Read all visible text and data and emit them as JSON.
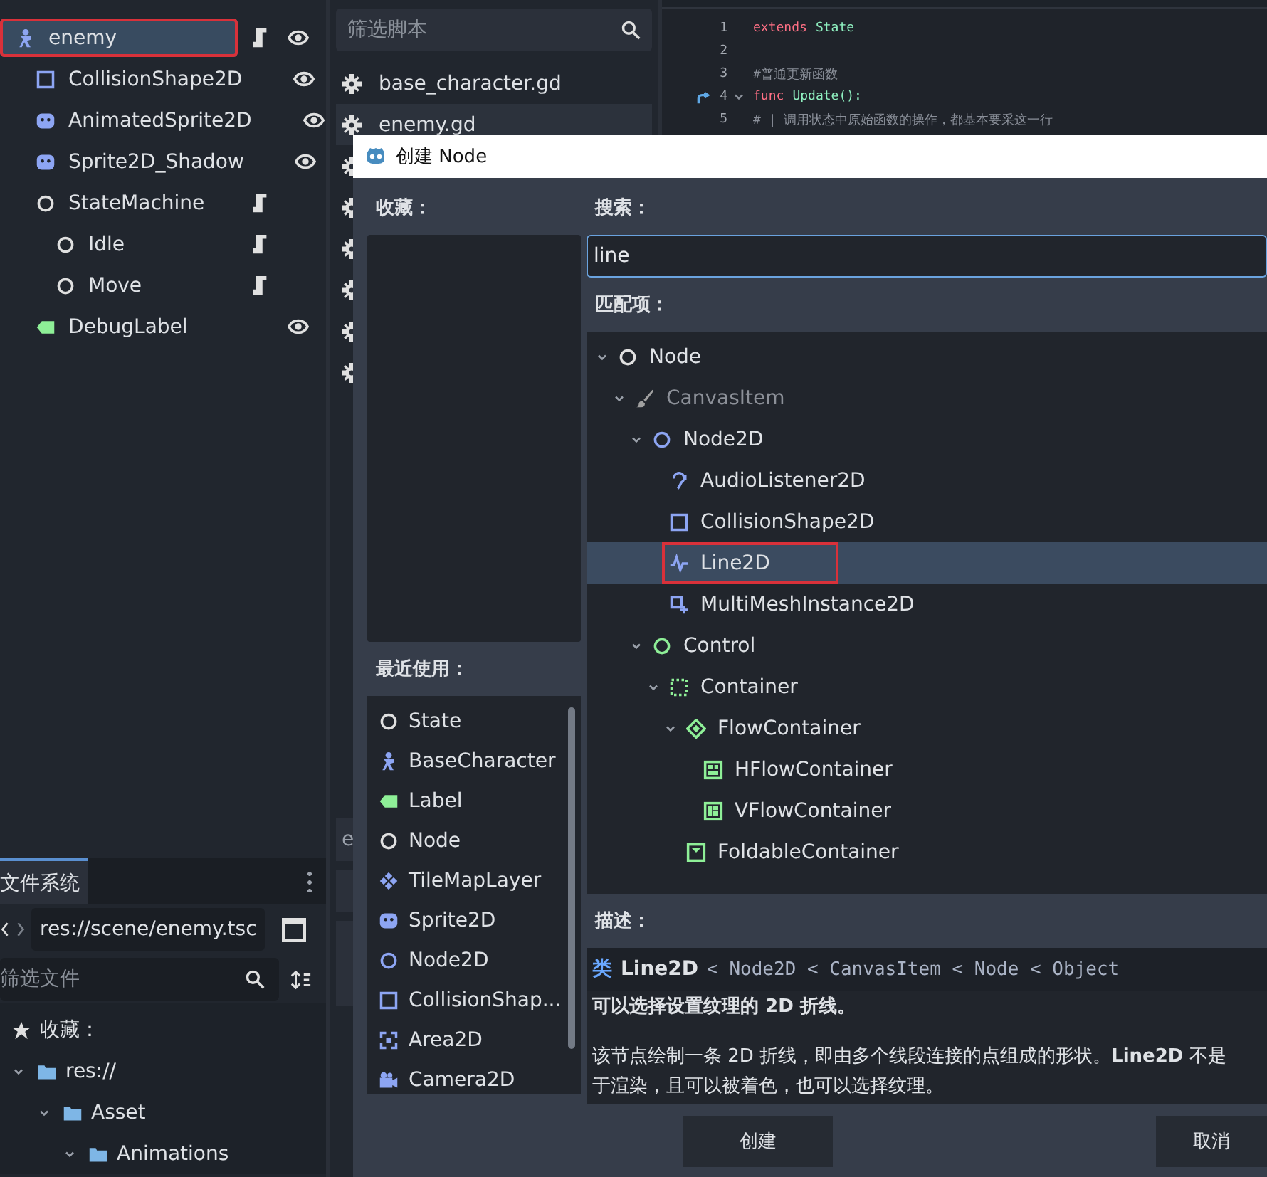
{
  "scene_tree": [
    {
      "label": "enemy",
      "kind": "figure",
      "color": "#8da5f3",
      "selected": true,
      "annotated": true,
      "has_script": true,
      "has_eye": true,
      "children": [
        {
          "label": "CollisionShape2D",
          "kind": "square",
          "color": "#8da5f3",
          "selected": false,
          "annotated": false,
          "has_script": false,
          "has_eye": true
        },
        {
          "label": "AnimatedSprite2D",
          "kind": "face",
          "color": "#8da5f3",
          "selected": false,
          "annotated": false,
          "has_script": false,
          "has_eye": true
        },
        {
          "label": "Sprite2D_Shadow",
          "kind": "face",
          "color": "#8da5f3",
          "selected": false,
          "annotated": false,
          "has_script": false,
          "has_eye": true
        },
        {
          "label": "StateMachine",
          "kind": "circle",
          "color": "#e0e0e0",
          "selected": false,
          "annotated": false,
          "has_script": true,
          "has_eye": false,
          "children": [
            {
              "label": "Idle",
              "kind": "circle",
              "color": "#e0e0e0",
              "selected": false,
              "annotated": false,
              "has_script": true,
              "has_eye": false
            },
            {
              "label": "Move",
              "kind": "circle",
              "color": "#e0e0e0",
              "selected": false,
              "annotated": false,
              "has_script": true,
              "has_eye": false
            }
          ]
        },
        {
          "label": "DebugLabel",
          "kind": "tag",
          "color": "#8eef97",
          "selected": false,
          "annotated": false,
          "has_script": false,
          "has_eye": true
        }
      ]
    }
  ],
  "filesystem": {
    "tab": "文件系统",
    "path": "res://scene/enemy.tsc",
    "filter_placeholder": "筛选文件",
    "items": [
      {
        "label": "收藏：",
        "kind": "star"
      },
      {
        "label": "res://",
        "kind": "folder",
        "children": [
          {
            "label": "Asset",
            "kind": "folder",
            "children": [
              {
                "label": "Animations",
                "kind": "folder"
              }
            ]
          }
        ]
      }
    ]
  },
  "scripts": {
    "filter_placeholder": "筛选脚本",
    "items": [
      {
        "label": "base_character.gd",
        "selected": false
      },
      {
        "label": "enemy.gd",
        "selected": true
      }
    ],
    "bottom_tabs": [
      "e"
    ]
  },
  "code": {
    "lines": [
      {
        "number": "1",
        "kind": "keyword",
        "keyword": "extends",
        "text": "State",
        "foldable": false,
        "override": false
      },
      {
        "number": "2",
        "kind": "blank",
        "foldable": false,
        "override": false
      },
      {
        "number": "3",
        "kind": "comment",
        "text": "#普通更新函数",
        "foldable": false,
        "override": false
      },
      {
        "number": "4",
        "kind": "keyword",
        "keyword": "func",
        "text": "Update():",
        "foldable": true,
        "override": true
      },
      {
        "number": "5",
        "kind": "comment",
        "text": "# | 调用状态中原始函数的操作，都基本要采这一行",
        "foldable": false,
        "override": false
      }
    ]
  },
  "dialog": {
    "title": "创建 Node",
    "favorites_label": "收藏：",
    "recent_label": "最近使用：",
    "recent": [
      {
        "label": "State",
        "kind": "circle",
        "color": "#e0e0e0"
      },
      {
        "label": "BaseCharacter",
        "kind": "figure",
        "color": "#8da5f3"
      },
      {
        "label": "Label",
        "kind": "tag",
        "color": "#8eef97"
      },
      {
        "label": "Node",
        "kind": "circle",
        "color": "#e0e0e0"
      },
      {
        "label": "TileMapLayer",
        "kind": "tiles",
        "color": "#8da5f3"
      },
      {
        "label": "Sprite2D",
        "kind": "face",
        "color": "#8da5f3"
      },
      {
        "label": "Node2D",
        "kind": "circle",
        "color": "#8da5f3"
      },
      {
        "label": "CollisionShap...",
        "kind": "square",
        "color": "#8da5f3"
      },
      {
        "label": "Area2D",
        "kind": "corners",
        "color": "#8da5f3"
      },
      {
        "label": "Camera2D",
        "kind": "camera",
        "color": "#8da5f3"
      }
    ],
    "search_label": "搜索：",
    "search_value": "line",
    "matches_label": "匹配项：",
    "matches": [
      {
        "label": "Node",
        "kind": "circle",
        "color": "#e0e0e0",
        "disabled": false,
        "selected": false,
        "annotated": false,
        "children": [
          {
            "label": "CanvasItem",
            "kind": "brush",
            "color": "#a0a0a0",
            "disabled": true,
            "selected": false,
            "annotated": false,
            "children": [
              {
                "label": "Node2D",
                "kind": "circle",
                "color": "#8da5f3",
                "disabled": false,
                "selected": false,
                "annotated": false,
                "children": [
                  {
                    "label": "AudioListener2D",
                    "kind": "ear",
                    "color": "#8da5f3",
                    "disabled": false,
                    "selected": false,
                    "annotated": false
                  },
                  {
                    "label": "CollisionShape2D",
                    "kind": "square",
                    "color": "#8da5f3",
                    "disabled": false,
                    "selected": false,
                    "annotated": false
                  },
                  {
                    "label": "Line2D",
                    "kind": "wave",
                    "color": "#8da5f3",
                    "disabled": false,
                    "selected": true,
                    "annotated": true
                  },
                  {
                    "label": "MultiMeshInstance2D",
                    "kind": "multimesh",
                    "color": "#8da5f3",
                    "disabled": false,
                    "selected": false,
                    "annotated": false
                  }
                ]
              },
              {
                "label": "Control",
                "kind": "circle",
                "color": "#8eef97",
                "disabled": false,
                "selected": false,
                "annotated": false,
                "children": [
                  {
                    "label": "Container",
                    "kind": "dotted",
                    "color": "#8eef97",
                    "disabled": false,
                    "selected": false,
                    "annotated": false,
                    "children": [
                      {
                        "label": "FlowContainer",
                        "kind": "diamond",
                        "color": "#8eef97",
                        "disabled": false,
                        "selected": false,
                        "annotated": false,
                        "children": [
                          {
                            "label": "HFlowContainer",
                            "kind": "hflow",
                            "color": "#8eef97",
                            "disabled": false,
                            "selected": false,
                            "annotated": false
                          },
                          {
                            "label": "VFlowContainer",
                            "kind": "vflow",
                            "color": "#8eef97",
                            "disabled": false,
                            "selected": false,
                            "annotated": false
                          }
                        ]
                      },
                      {
                        "label": "FoldableContainer",
                        "kind": "foldable",
                        "color": "#8eef97",
                        "disabled": false,
                        "selected": false,
                        "annotated": false
                      }
                    ]
                  }
                ]
              }
            ]
          }
        ]
      }
    ],
    "description_label": "描述：",
    "description": {
      "class_word": "类",
      "class_name": "Line2D",
      "chain": "< Node2D < CanvasItem < Node < Object",
      "summary": "可以选择设置纹理的 2D 折线。",
      "body_lines": [
        "该节点绘制一条 2D 折线，即由多个线段连接的点组成的形状。**Line2D** 不是",
        "于渲染，且可以被着色，也可以选择纹理。"
      ]
    },
    "buttons": [
      {
        "label": "创建",
        "kind": "confirm"
      },
      {
        "label": "取消",
        "kind": "cancel"
      }
    ]
  }
}
